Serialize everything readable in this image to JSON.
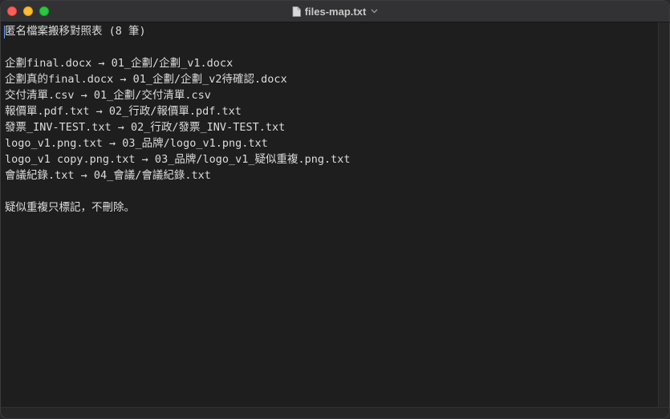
{
  "window": {
    "title": "files-map.txt"
  },
  "document": {
    "lines": [
      "匿名檔案搬移對照表 (8 筆)",
      "",
      "企劃final.docx → 01_企劃/企劃_v1.docx",
      "企劃真的final.docx → 01_企劃/企劃_v2待確認.docx",
      "交付清單.csv → 01_企劃/交付清單.csv",
      "報價單.pdf.txt → 02_行政/報價單.pdf.txt",
      "發票_INV-TEST.txt → 02_行政/發票_INV-TEST.txt",
      "logo_v1.png.txt → 03_品牌/logo_v1.png.txt",
      "logo_v1 copy.png.txt → 03_品牌/logo_v1_疑似重複.png.txt",
      "會議紀錄.txt → 04_會議/會議紀錄.txt",
      "",
      "疑似重複只標記，不刪除。"
    ]
  },
  "icons": {
    "document": "document-icon",
    "chevron": "chevron-down-icon"
  },
  "colors": {
    "close": "#ff5f57",
    "minimize": "#febc2e",
    "zoom": "#28c840",
    "background": "#1e1e1e",
    "text": "#dcdcdc"
  }
}
